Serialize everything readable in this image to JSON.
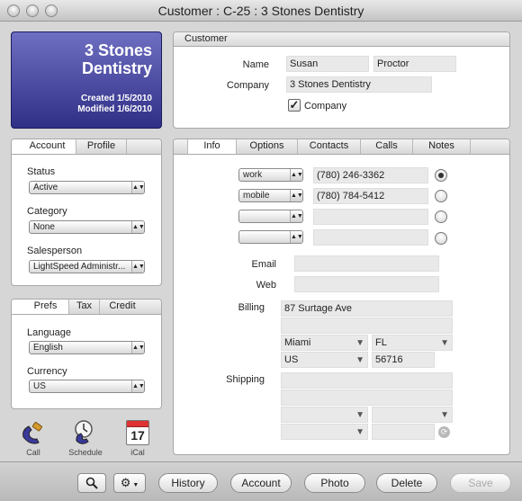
{
  "window": {
    "title": "Customer : C-25 : 3 Stones Dentistry"
  },
  "card": {
    "name_line1": "3 Stones",
    "name_line2": "Dentistry",
    "created": "Created 1/5/2010",
    "modified": "Modified 1/6/2010"
  },
  "customer": {
    "header": "Customer",
    "name_label": "Name",
    "first_name": "Susan",
    "last_name": "Proctor",
    "company_label": "Company",
    "company": "3 Stones Dentistry",
    "company_checkbox_label": "Company",
    "company_checked": true
  },
  "account_tabs": [
    "Account",
    "Profile"
  ],
  "account": {
    "status_label": "Status",
    "status_value": "Active",
    "category_label": "Category",
    "category_value": "None",
    "salesperson_label": "Salesperson",
    "salesperson_value": "LightSpeed Administr..."
  },
  "prefs_tabs": [
    "Prefs",
    "Tax",
    "Credit"
  ],
  "prefs": {
    "language_label": "Language",
    "language_value": "English",
    "currency_label": "Currency",
    "currency_value": "US"
  },
  "action_icons": {
    "call": "Call",
    "schedule": "Schedule",
    "ical": "iCal",
    "ical_day": "17"
  },
  "info_tabs": [
    "Info",
    "Options",
    "Contacts",
    "Calls",
    "Notes"
  ],
  "info": {
    "phones": [
      {
        "type": "work",
        "number": "(780) 246-3362",
        "primary": true
      },
      {
        "type": "mobile",
        "number": "(780) 784-5412",
        "primary": false
      },
      {
        "type": "",
        "number": "",
        "primary": false
      },
      {
        "type": "",
        "number": "",
        "primary": false
      }
    ],
    "email_label": "Email",
    "email": "",
    "web_label": "Web",
    "web": "",
    "billing_label": "Billing",
    "billing": {
      "address1": "87 Surtage Ave",
      "address2": "",
      "city": "Miami",
      "state": "FL",
      "country": "US",
      "zip": "56716"
    },
    "shipping_label": "Shipping",
    "shipping": {
      "address1": "",
      "address2": "",
      "city": "",
      "state": "",
      "country": "",
      "zip": ""
    }
  },
  "toolbar": {
    "buttons": [
      "History",
      "Account",
      "Photo",
      "Delete",
      "Save"
    ]
  },
  "icons": {
    "search": "search-icon",
    "gear": "gear-icon",
    "arrow": "▼"
  }
}
